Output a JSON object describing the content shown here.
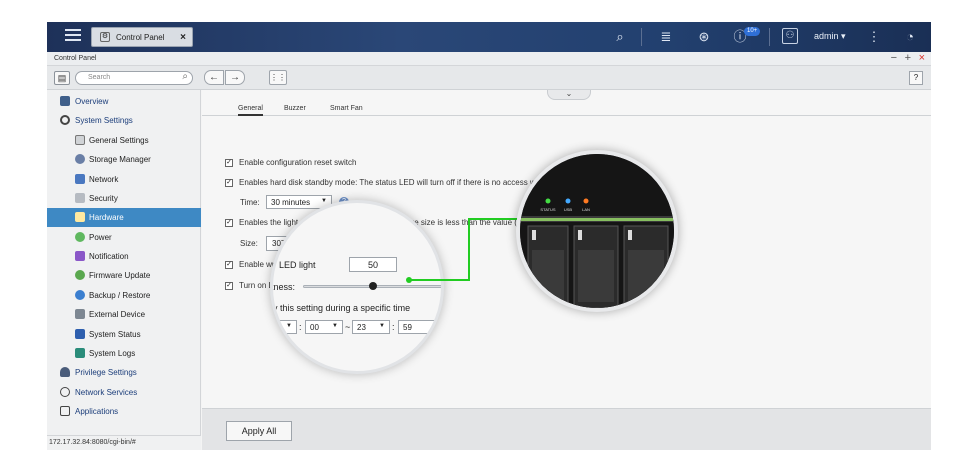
{
  "topbar": {
    "app_tab_title": "Control Panel",
    "notification_count": "10+",
    "user": "admin"
  },
  "window": {
    "title": "Control Panel"
  },
  "toolbar": {
    "search_placeholder": "Search",
    "help": "?"
  },
  "sidebar": {
    "items": [
      {
        "label": "Overview",
        "icon": "overview-icon"
      },
      {
        "label": "System Settings",
        "icon": "gear-icon"
      },
      {
        "label": "General Settings",
        "icon": "general-settings-icon"
      },
      {
        "label": "Storage Manager",
        "icon": "storage-icon"
      },
      {
        "label": "Network",
        "icon": "network-icon"
      },
      {
        "label": "Security",
        "icon": "lock-icon"
      },
      {
        "label": "Hardware",
        "icon": "hardware-icon"
      },
      {
        "label": "Power",
        "icon": "power-icon"
      },
      {
        "label": "Notification",
        "icon": "notification-icon"
      },
      {
        "label": "Firmware Update",
        "icon": "firmware-icon"
      },
      {
        "label": "Backup / Restore",
        "icon": "backup-icon"
      },
      {
        "label": "External Device",
        "icon": "external-device-icon"
      },
      {
        "label": "System Status",
        "icon": "status-icon"
      },
      {
        "label": "System Logs",
        "icon": "logs-icon"
      },
      {
        "label": "Privilege Settings",
        "icon": "privilege-icon"
      },
      {
        "label": "Network Services",
        "icon": "network-services-icon"
      },
      {
        "label": "Applications",
        "icon": "applications-icon"
      }
    ],
    "selected": "Hardware",
    "status_url": "172.17.32.84:8080/cgi-bin/#"
  },
  "tabs": [
    "General",
    "Buzzer",
    "Smart Fan"
  ],
  "settings": {
    "reset_switch": "Enable configuration reset switch",
    "standby": "Enables hard disk standby mode: The status LED will turn off if there is no access within",
    "time_label": "Time:",
    "time_value": "30 minutes",
    "light_signal": "Enables the light signal alert when the free storage size is less than the value (Or",
    "size_label": "Size:",
    "size_value": "3072",
    "size_unit": "MB",
    "write_cache": "Enable write cache (EXT4 delay allocation)",
    "led_light": "Turn on LED light",
    "led_value": "50",
    "brightness_label": "LED brightness:",
    "brightness_level": 0.45,
    "schedule": "Apply this setting during a specific time",
    "start_hour": "00",
    "start_min": "00",
    "end_hour": "23",
    "end_min": "59"
  },
  "footer": {
    "apply": "Apply All"
  },
  "led_labels": [
    "STATUS",
    "USB",
    "LAN"
  ],
  "colors": {
    "accent": "#3e89c4",
    "highlight": "#22cc22"
  }
}
